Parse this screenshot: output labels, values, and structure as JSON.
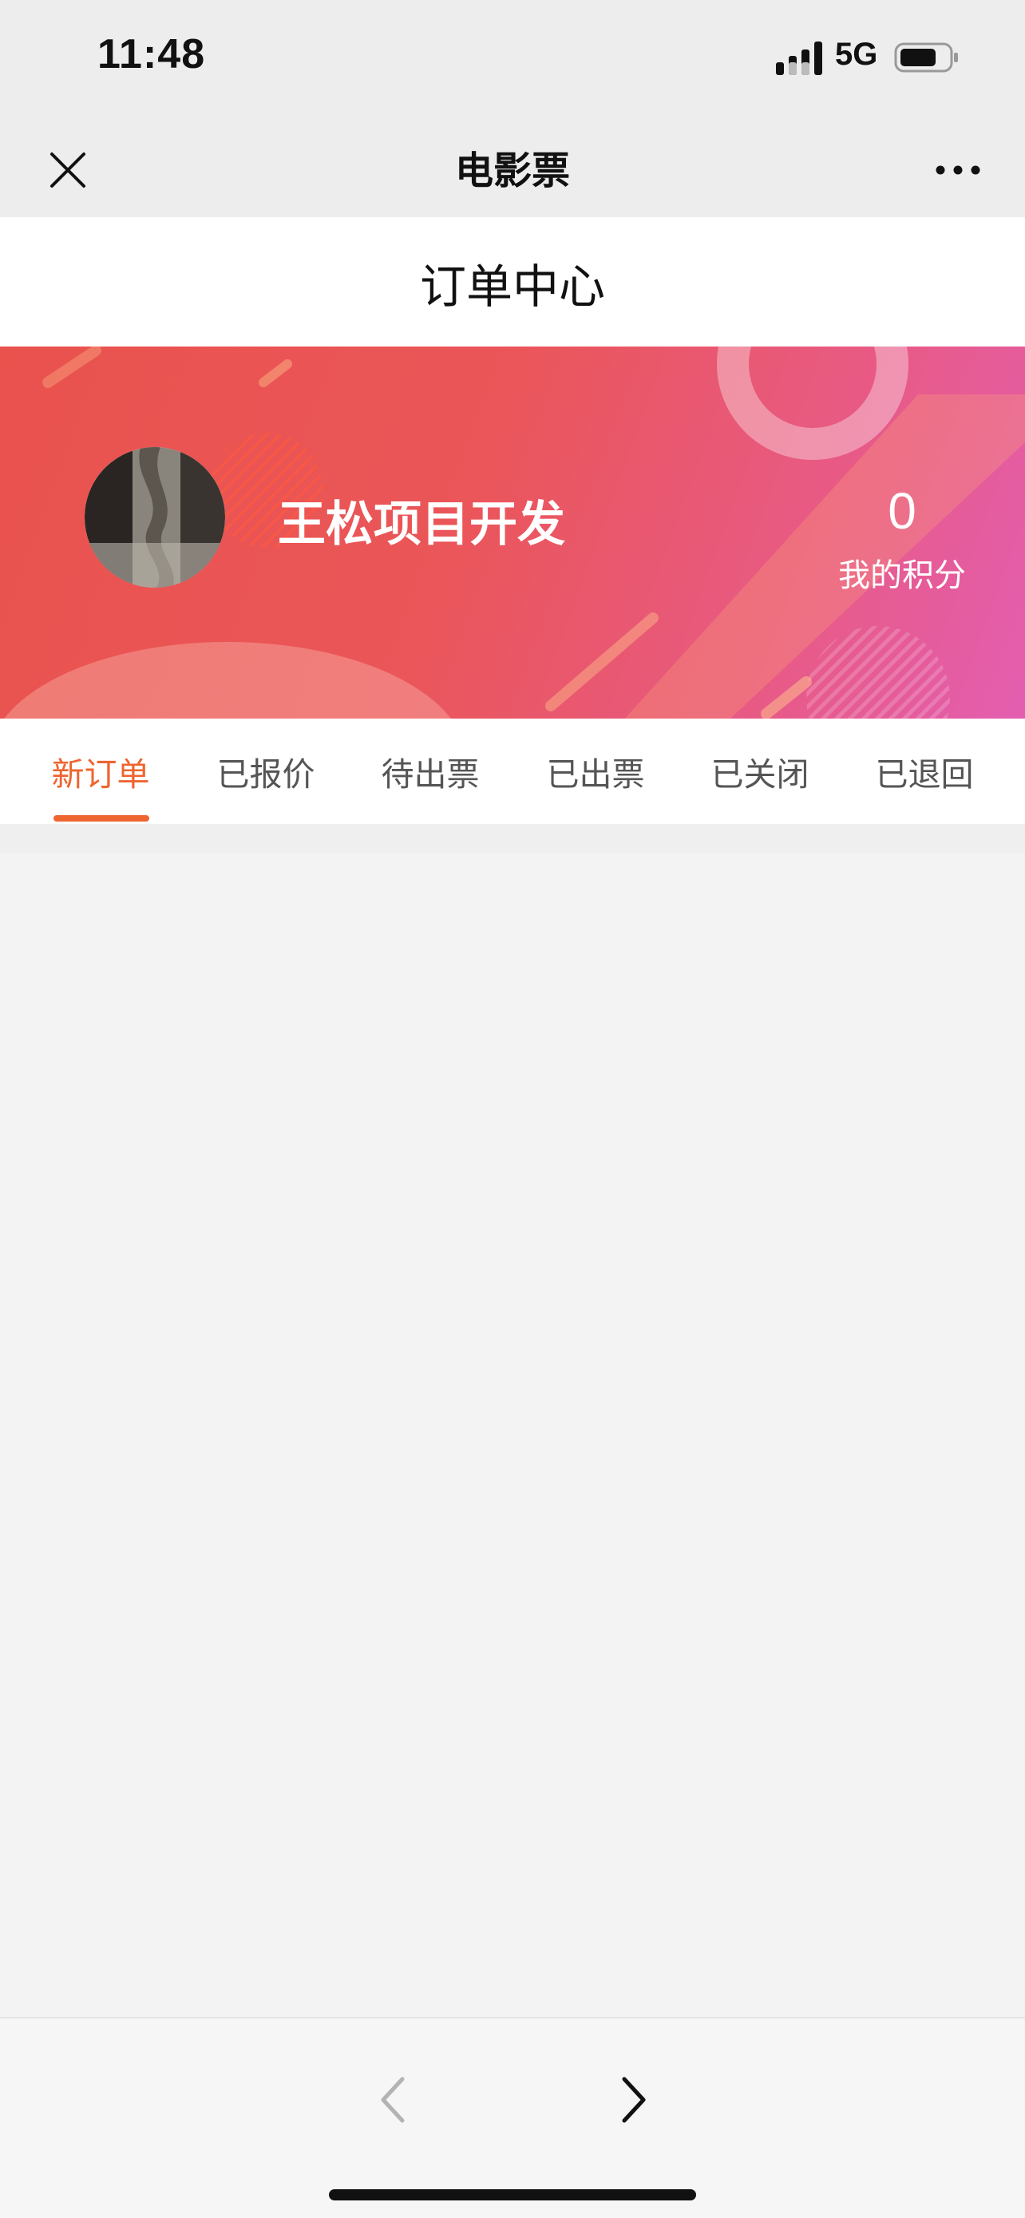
{
  "status_bar": {
    "time": "11:48",
    "network": "5G",
    "icons": [
      "signal-icon",
      "battery-icon"
    ]
  },
  "nav_bar": {
    "title": "电影票",
    "close_icon": "close-icon",
    "more_icon": "more-dots-icon"
  },
  "page": {
    "title": "订单中心"
  },
  "profile": {
    "username": "王松项目开发",
    "points_value": "0",
    "points_label": "我的积分"
  },
  "tabs": [
    {
      "label": "新订单",
      "active": true
    },
    {
      "label": "已报价",
      "active": false
    },
    {
      "label": "待出票",
      "active": false
    },
    {
      "label": "已出票",
      "active": false
    },
    {
      "label": "已关闭",
      "active": false
    },
    {
      "label": "已退回",
      "active": false
    }
  ],
  "bottom_bar": {
    "back_icon": "chevron-left-icon",
    "forward_icon": "chevron-right-icon",
    "back_enabled": false,
    "forward_enabled": true
  },
  "colors": {
    "accent": "#ee6530",
    "banner_start": "#e9524d",
    "banner_end": "#e35eb0"
  }
}
